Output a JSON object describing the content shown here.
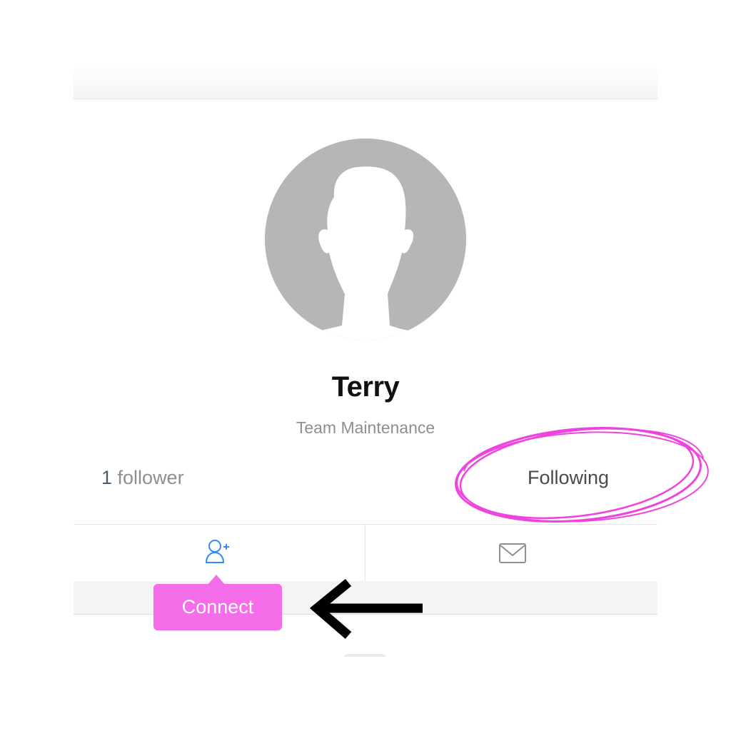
{
  "profile": {
    "name": "Terry",
    "team": "Team Maintenance",
    "followers_count": "1",
    "followers_label": " follower",
    "following_label": "Following"
  },
  "actions": {
    "connect_icon": "user-plus-icon",
    "message_icon": "envelope-icon",
    "tooltip_label": "Connect"
  },
  "colors": {
    "accent_blue": "#2f8df0",
    "tooltip_pink": "#f56de8",
    "annotation_magenta": "#ee44dd",
    "avatar_gray": "#b5b6b8"
  }
}
